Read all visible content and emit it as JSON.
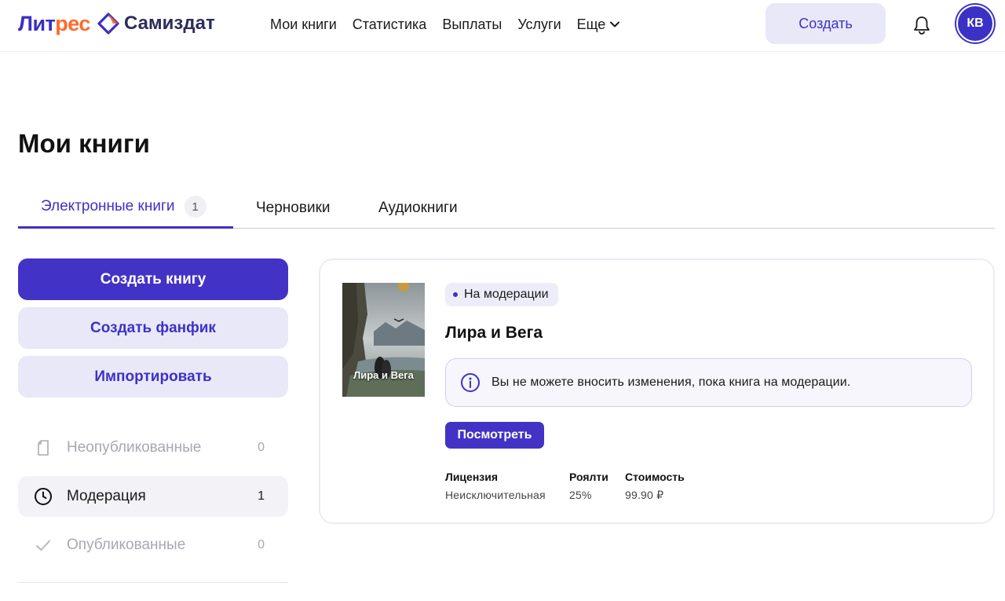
{
  "brand": {
    "litres_part1": "Лит",
    "litres_part2": "рес",
    "samizdat": "Самиздат",
    "colors": {
      "primary": "#4233c6",
      "accent": "#ff6a2c"
    }
  },
  "nav": {
    "items": [
      "Мои книги",
      "Статистика",
      "Выплаты",
      "Услуги"
    ],
    "more_label": "Еще",
    "create_label": "Создать",
    "avatar_initials": "КВ"
  },
  "page": {
    "title": "Мои книги"
  },
  "tabs": [
    {
      "label": "Электронные книги",
      "badge": "1",
      "active": true
    },
    {
      "label": "Черновики"
    },
    {
      "label": "Аудиокниги"
    }
  ],
  "sidebar": {
    "create_book": "Создать книгу",
    "create_fanfic": "Создать фанфик",
    "import": "Импортировать",
    "filters": [
      {
        "label": "Неопубликованные",
        "count": "0",
        "icon": "document-icon"
      },
      {
        "label": "Модерация",
        "count": "1",
        "icon": "clock-icon",
        "active": true
      },
      {
        "label": "Опубликованные",
        "count": "0",
        "icon": "check-icon"
      }
    ]
  },
  "book": {
    "cover_title": "Лира и Вега",
    "status": "На модерации",
    "title": "Лира и Вега",
    "notice": "Вы не можете вносить изменения, пока книга на модерации.",
    "view_label": "Посмотреть",
    "meta": [
      {
        "label": "Лицензия",
        "value": "Неисключительная"
      },
      {
        "label": "Роялти",
        "value": "25%"
      },
      {
        "label": "Стоимость",
        "value": "99.90 ₽"
      }
    ]
  }
}
